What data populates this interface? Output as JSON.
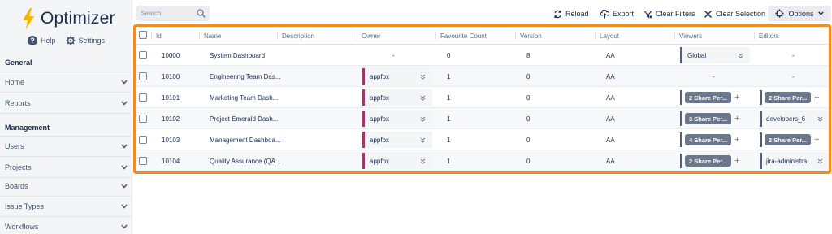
{
  "brand": {
    "name": "Optimizer"
  },
  "sidebar": {
    "help_label": "Help",
    "settings_label": "Settings",
    "general_title": "General",
    "management_title": "Management",
    "general_items": [
      {
        "label": "Home"
      },
      {
        "label": "Reports"
      }
    ],
    "management_items": [
      {
        "label": "Users"
      },
      {
        "label": "Projects"
      },
      {
        "label": "Boards"
      },
      {
        "label": "Issue Types"
      },
      {
        "label": "Workflows"
      }
    ]
  },
  "toolbar": {
    "search_placeholder": "Search",
    "reload_label": "Reload",
    "export_label": "Export",
    "clear_filters_label": "Clear Filters",
    "clear_selection_label": "Clear Selection",
    "options_label": "Options"
  },
  "table": {
    "headers": {
      "id": "Id",
      "name": "Name",
      "description": "Description",
      "owner": "Owner",
      "favourite": "Favourite Count",
      "version": "Version",
      "layout": "Layout",
      "viewers": "Viewers",
      "editors": "Editors"
    },
    "rows": [
      {
        "id": "10000",
        "name": "System Dashboard",
        "owner": "-",
        "favourite": "0",
        "version": "8",
        "layout": "AA",
        "viewers": "Global",
        "editors": "-"
      },
      {
        "id": "10100",
        "name": "Engineering Team Das...",
        "owner": "appfox",
        "favourite": "1",
        "version": "0",
        "layout": "AA",
        "viewers": "-",
        "editors": "-"
      },
      {
        "id": "10101",
        "name": "Marketing Team Dash...",
        "owner": "appfox",
        "favourite": "1",
        "version": "0",
        "layout": "AA",
        "viewers": "2 Share Per...",
        "editors": "2 Share Per..."
      },
      {
        "id": "10102",
        "name": "Project Emerald Dash...",
        "owner": "appfox",
        "favourite": "1",
        "version": "0",
        "layout": "AA",
        "viewers": "3 Share Per...",
        "editors": "developers_6"
      },
      {
        "id": "10103",
        "name": "Management Dashboa...",
        "owner": "appfox",
        "favourite": "1",
        "version": "0",
        "layout": "AA",
        "viewers": "4 Share Per...",
        "editors": "2 Share Per..."
      },
      {
        "id": "10104",
        "name": "Quality Assurance (QA...",
        "owner": "appfox",
        "favourite": "1",
        "version": "0",
        "layout": "AA",
        "viewers": "2 Share Per...",
        "editors": "jira-administra..."
      }
    ]
  },
  "colors": {
    "accent_border": "#f28c1c",
    "owner_marker": "#a8346a",
    "bolt": "#f4b400"
  },
  "icons": [
    "bolt-icon",
    "help-icon",
    "gear-icon",
    "chevron-down-icon",
    "search-icon",
    "reload-icon",
    "export-icon",
    "filter-icon",
    "close-icon",
    "plus-icon"
  ]
}
